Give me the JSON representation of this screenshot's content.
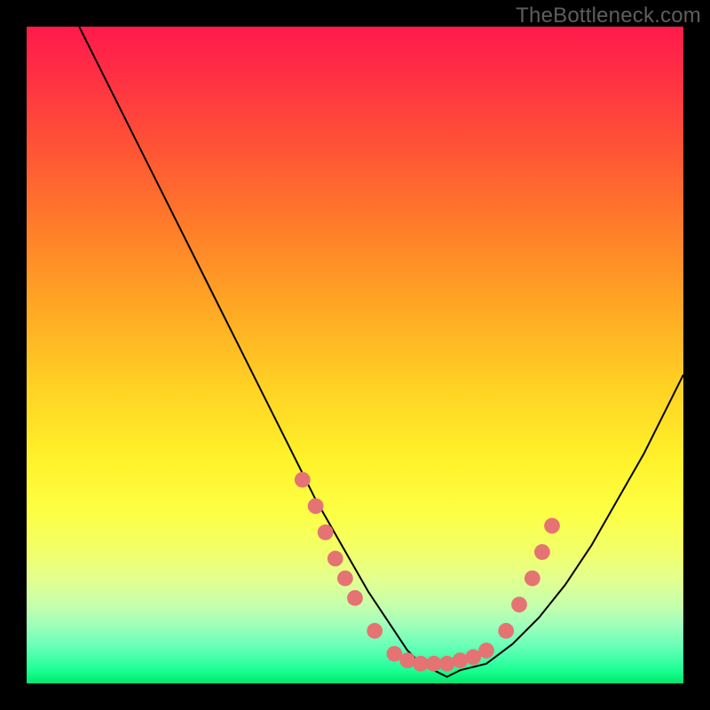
{
  "watermark": "TheBottleneck.com",
  "chart_data": {
    "type": "line",
    "title": "",
    "xlabel": "",
    "ylabel": "",
    "xlim": [
      0,
      100
    ],
    "ylim": [
      0,
      100
    ],
    "grid": false,
    "series": [
      {
        "name": "curve",
        "color": "#000000",
        "x": [
          8,
          12,
          16,
          20,
          24,
          28,
          32,
          36,
          40,
          44,
          48,
          52,
          56,
          58,
          60,
          62,
          64,
          66,
          70,
          74,
          78,
          82,
          86,
          90,
          94,
          98,
          100
        ],
        "y": [
          100,
          92,
          84,
          76,
          68,
          60,
          52,
          44,
          36,
          28,
          21,
          14,
          8,
          5,
          3,
          2,
          1,
          2,
          3,
          6,
          10,
          15,
          21,
          28,
          35,
          43,
          47
        ]
      }
    ],
    "markers": {
      "name": "dots",
      "color": "#e57373",
      "radius_pct": 1.2,
      "points": [
        {
          "x": 42,
          "y": 31
        },
        {
          "x": 44,
          "y": 27
        },
        {
          "x": 45.5,
          "y": 23
        },
        {
          "x": 47,
          "y": 19
        },
        {
          "x": 48.5,
          "y": 16
        },
        {
          "x": 50,
          "y": 13
        },
        {
          "x": 53,
          "y": 8
        },
        {
          "x": 56,
          "y": 4.5
        },
        {
          "x": 58,
          "y": 3.5
        },
        {
          "x": 60,
          "y": 3
        },
        {
          "x": 62,
          "y": 3
        },
        {
          "x": 64,
          "y": 3
        },
        {
          "x": 66,
          "y": 3.5
        },
        {
          "x": 68,
          "y": 4
        },
        {
          "x": 70,
          "y": 5
        },
        {
          "x": 73,
          "y": 8
        },
        {
          "x": 75,
          "y": 12
        },
        {
          "x": 77,
          "y": 16
        },
        {
          "x": 78.5,
          "y": 20
        },
        {
          "x": 80,
          "y": 24
        }
      ]
    }
  }
}
